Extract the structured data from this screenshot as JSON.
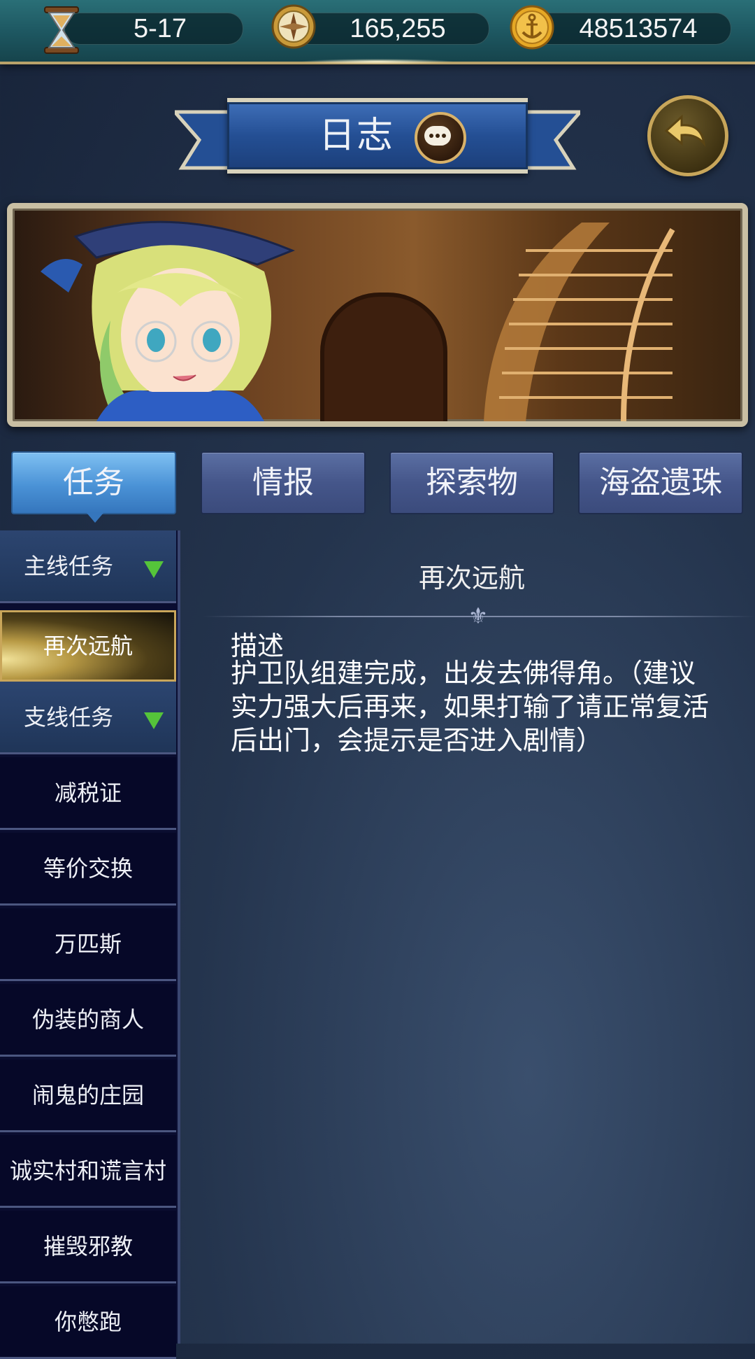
{
  "resources": {
    "day": "5-17",
    "compass_value": "165,255",
    "gold": "48513574"
  },
  "header": {
    "title": "日志"
  },
  "tabs": [
    {
      "label": "任务",
      "active": true
    },
    {
      "label": "情报",
      "active": false
    },
    {
      "label": "探索物",
      "active": false
    },
    {
      "label": "海盗遗珠",
      "active": false
    }
  ],
  "sidebar": {
    "items": [
      {
        "label": "主线任务",
        "type": "category"
      },
      {
        "label": "再次远航",
        "type": "quest",
        "selected": true
      },
      {
        "label": "支线任务",
        "type": "category"
      },
      {
        "label": "减税证",
        "type": "quest"
      },
      {
        "label": "等价交换",
        "type": "quest"
      },
      {
        "label": "万匹斯",
        "type": "quest"
      },
      {
        "label": "伪装的商人",
        "type": "quest"
      },
      {
        "label": "闹鬼的庄园",
        "type": "quest"
      },
      {
        "label": "诚实村和谎言村",
        "type": "quest"
      },
      {
        "label": "摧毁邪教",
        "type": "quest"
      },
      {
        "label": "你憋跑",
        "type": "quest"
      }
    ]
  },
  "detail": {
    "title": "再次远航",
    "desc_label": "描述",
    "desc_text": "护卫队组建完成，出发去佛得角。（建议实力强大后再来，如果打输了请正常复活后出门，会提示是否进入剧情）"
  },
  "colors": {
    "accent_gold": "#c9a65a",
    "tab_active": "#4a92d6",
    "tab_inactive": "#45568a",
    "category_arrow": "#55c43a"
  },
  "icons": [
    "hourglass-icon",
    "compass-icon",
    "anchor-coin-icon",
    "chat-bubble-icon",
    "back-arrow-icon"
  ]
}
